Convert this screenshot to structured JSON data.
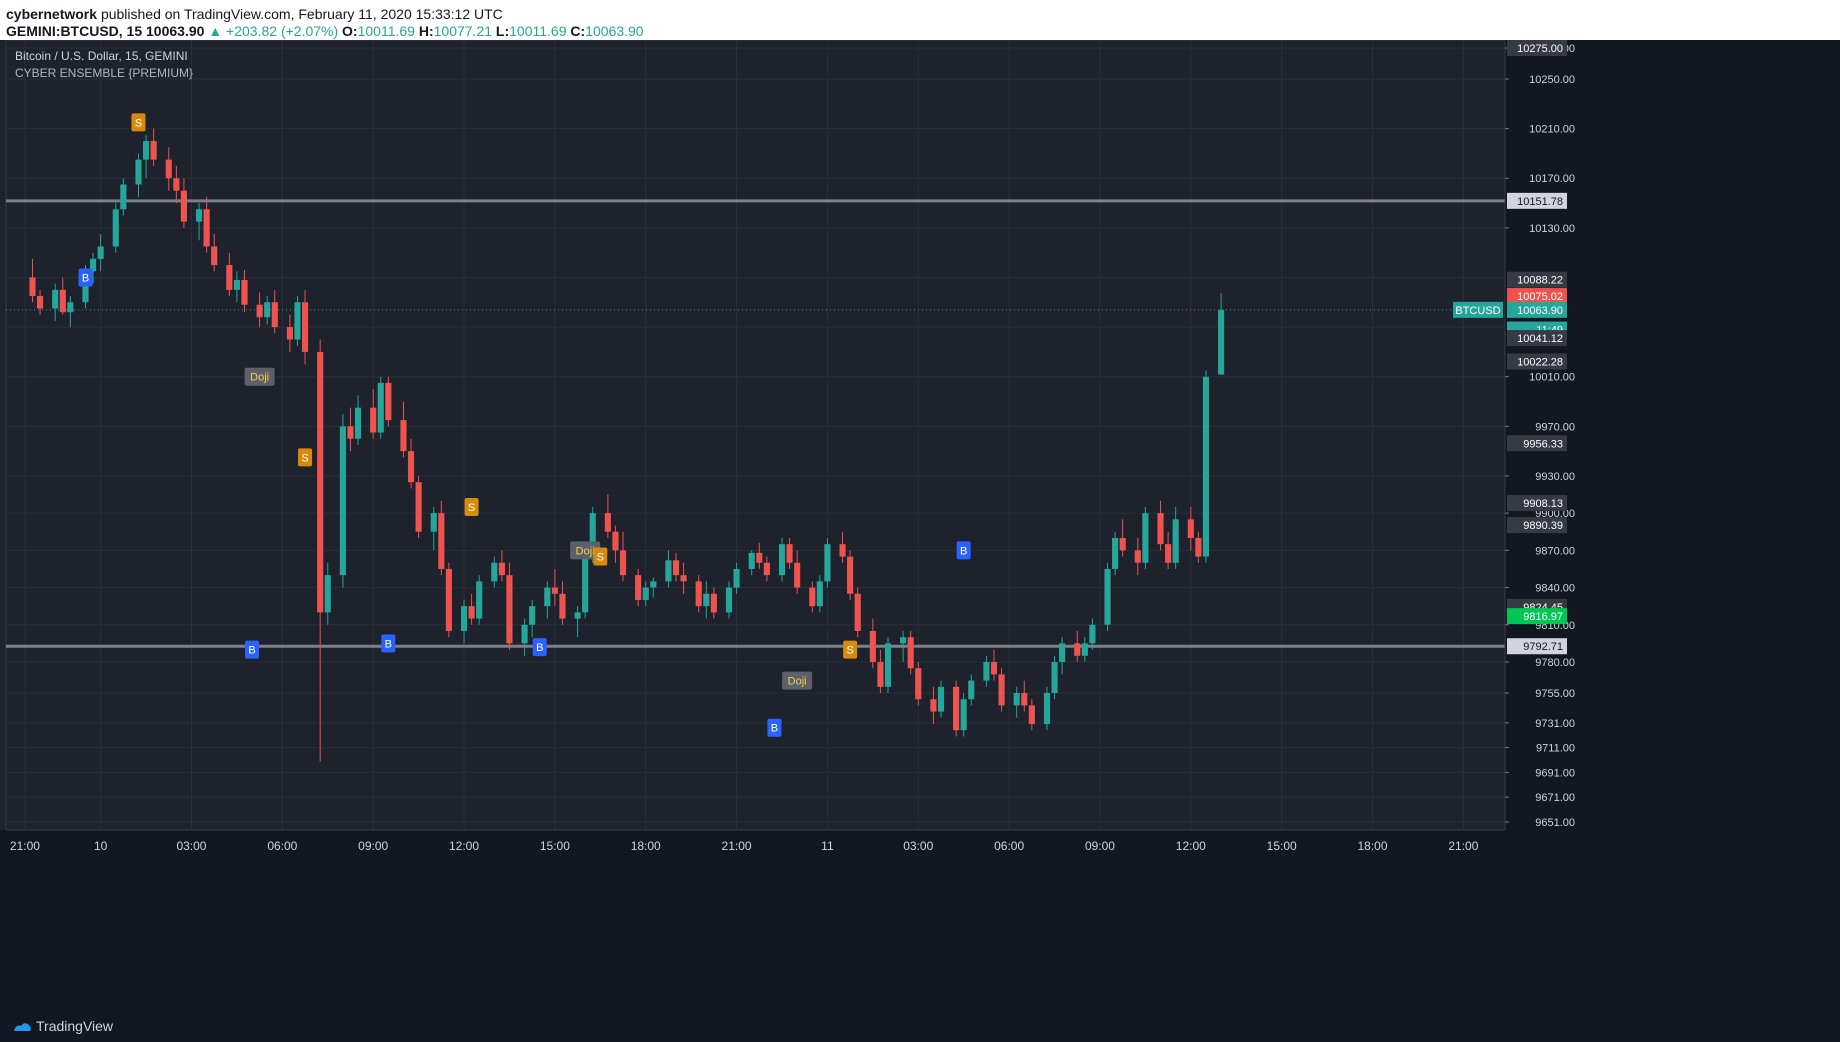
{
  "header": {
    "author": "cybernetwork",
    "published_text": "published on TradingView.com, February 11, 2020 15:33:12 UTC",
    "symbol": "GEMINI:BTCUSD, 15",
    "price": "10063.90",
    "change": "▲ +203.82 (+2.07%)",
    "ohlc": {
      "o_label": "O:",
      "o": "10011.69",
      "h_label": "H:",
      "h": "10077.21",
      "l_label": "L:",
      "l": "10011.69",
      "c_label": "C:",
      "c": "10063.90"
    }
  },
  "legend": {
    "title": "Bitcoin / U.S. Dollar, 15, GEMINI",
    "indicator": "CYBER ENSEMBLE {PREMIUM}"
  },
  "footer": {
    "brand": "TradingView"
  },
  "colors": {
    "up": "#26a69a",
    "down": "#ef5350",
    "background": "#1e222d",
    "grid": "#2a2e39",
    "axis_text": "#d1d4dc",
    "buy": "#2962ff",
    "sell": "#d88a0c"
  },
  "chart_data": {
    "type": "candlestick",
    "timeframe": "15",
    "ylim": [
      9651,
      10275
    ],
    "y_ticks": [
      10275,
      10250,
      10210,
      10170,
      10130,
      10090,
      10050,
      10010,
      9970,
      9930,
      9900,
      9870,
      9840,
      9810,
      9780,
      9755,
      9731,
      9711,
      9691,
      9671,
      9651
    ],
    "y_tick_labels": [
      "10275.00",
      "10250.00",
      "10210.00",
      "10170.00",
      "10130.00",
      "",
      "",
      "10010.00",
      "9970.00",
      "9930.00",
      "9900.00",
      "9870.00",
      "9840.00",
      "9810.00",
      "9780.00",
      "9755.00",
      "9731.00",
      "9711.00",
      "9691.00",
      "9671.00",
      "9651.00"
    ],
    "x_ticks": [
      "21:00",
      "10",
      "03:00",
      "06:00",
      "09:00",
      "12:00",
      "15:00",
      "18:00",
      "21:00",
      "11",
      "03:00",
      "06:00",
      "09:00",
      "12:00",
      "15:00",
      "18:00",
      "21:00"
    ],
    "x_tick_bar_index": [
      2,
      12,
      24,
      36,
      48,
      60,
      72,
      84,
      96,
      108,
      120,
      132,
      144,
      156,
      168,
      180,
      192
    ],
    "bars_total": 198,
    "ohlc": [
      [
        10090,
        10105,
        10070,
        10075
      ],
      [
        10075,
        10080,
        10060,
        10065
      ],
      [
        10065,
        10085,
        10055,
        10080
      ],
      [
        10080,
        10090,
        10060,
        10062
      ],
      [
        10062,
        10075,
        10050,
        10070
      ],
      [
        10070,
        10100,
        10065,
        10095
      ],
      [
        10095,
        10110,
        10085,
        10105
      ],
      [
        10105,
        10125,
        10095,
        10115
      ],
      [
        10115,
        10150,
        10110,
        10145
      ],
      [
        10145,
        10170,
        10140,
        10165
      ],
      [
        10165,
        10190,
        10155,
        10185
      ],
      [
        10185,
        10205,
        10170,
        10200
      ],
      [
        10200,
        10210,
        10180,
        10185
      ],
      [
        10185,
        10195,
        10160,
        10170
      ],
      [
        10170,
        10180,
        10150,
        10160
      ],
      [
        10160,
        10170,
        10130,
        10135
      ],
      [
        10135,
        10150,
        10120,
        10145
      ],
      [
        10145,
        10155,
        10110,
        10115
      ],
      [
        10115,
        10125,
        10095,
        10100
      ],
      [
        10100,
        10110,
        10075,
        10080
      ],
      [
        10080,
        10095,
        10070,
        10088
      ],
      [
        10088,
        10096,
        10062,
        10068
      ],
      [
        10068,
        10078,
        10050,
        10058
      ],
      [
        10058,
        10075,
        10052,
        10070
      ],
      [
        10070,
        10080,
        10045,
        10050
      ],
      [
        10050,
        10060,
        10030,
        10040
      ],
      [
        10040,
        10075,
        10035,
        10070
      ],
      [
        10070,
        10080,
        10020,
        10030
      ],
      [
        10030,
        10040,
        9700,
        9820
      ],
      [
        9820,
        9860,
        9810,
        9850
      ],
      [
        9850,
        9980,
        9840,
        9970
      ],
      [
        9970,
        9985,
        9950,
        9960
      ],
      [
        9960,
        9995,
        9955,
        9985
      ],
      [
        9985,
        10000,
        9960,
        9965
      ],
      [
        9965,
        10010,
        9960,
        10005
      ],
      [
        10005,
        10010,
        9970,
        9975
      ],
      [
        9975,
        9990,
        9945,
        9950
      ],
      [
        9950,
        9960,
        9920,
        9925
      ],
      [
        9925,
        9930,
        9880,
        9885
      ],
      [
        9885,
        9905,
        9870,
        9900
      ],
      [
        9900,
        9910,
        9850,
        9855
      ],
      [
        9855,
        9860,
        9800,
        9805
      ],
      [
        9805,
        9830,
        9795,
        9825
      ],
      [
        9825,
        9835,
        9810,
        9815
      ],
      [
        9815,
        9850,
        9810,
        9845
      ],
      [
        9845,
        9865,
        9840,
        9860
      ],
      [
        9860,
        9870,
        9845,
        9850
      ],
      [
        9850,
        9860,
        9790,
        9795
      ],
      [
        9795,
        9815,
        9785,
        9810
      ],
      [
        9810,
        9830,
        9800,
        9825
      ],
      [
        9825,
        9845,
        9815,
        9840
      ],
      [
        9840,
        9855,
        9825,
        9835
      ],
      [
        9835,
        9845,
        9810,
        9815
      ],
      [
        9815,
        9825,
        9800,
        9820
      ],
      [
        9820,
        9870,
        9815,
        9865
      ],
      [
        9865,
        9905,
        9860,
        9900
      ],
      [
        9900,
        9915,
        9880,
        9885
      ],
      [
        9885,
        9890,
        9860,
        9870
      ],
      [
        9870,
        9885,
        9845,
        9850
      ],
      [
        9850,
        9855,
        9825,
        9830
      ],
      [
        9830,
        9845,
        9825,
        9840
      ],
      [
        9840,
        9848,
        9832,
        9845
      ],
      [
        9845,
        9870,
        9840,
        9862
      ],
      [
        9862,
        9868,
        9845,
        9850
      ],
      [
        9850,
        9860,
        9835,
        9845
      ],
      [
        9845,
        9850,
        9820,
        9825
      ],
      [
        9825,
        9845,
        9815,
        9835
      ],
      [
        9835,
        9840,
        9815,
        9820
      ],
      [
        9820,
        9845,
        9815,
        9840
      ],
      [
        9840,
        9860,
        9835,
        9855
      ],
      [
        9855,
        9870,
        9850,
        9868
      ],
      [
        9868,
        9876,
        9855,
        9860
      ],
      [
        9860,
        9865,
        9845,
        9850
      ],
      [
        9850,
        9880,
        9845,
        9875
      ],
      [
        9875,
        9880,
        9855,
        9860
      ],
      [
        9860,
        9870,
        9835,
        9840
      ],
      [
        9840,
        9845,
        9820,
        9825
      ],
      [
        9825,
        9850,
        9820,
        9845
      ],
      [
        9845,
        9880,
        9840,
        9875
      ],
      [
        9875,
        9885,
        9860,
        9865
      ],
      [
        9865,
        9870,
        9830,
        9835
      ],
      [
        9835,
        9840,
        9800,
        9805
      ],
      [
        9805,
        9815,
        9775,
        9780
      ],
      [
        9780,
        9790,
        9755,
        9760
      ],
      [
        9760,
        9800,
        9755,
        9795
      ],
      [
        9795,
        9805,
        9780,
        9800
      ],
      [
        9800,
        9805,
        9770,
        9775
      ],
      [
        9775,
        9780,
        9745,
        9750
      ],
      [
        9750,
        9760,
        9730,
        9740
      ],
      [
        9740,
        9765,
        9735,
        9760
      ],
      [
        9760,
        9765,
        9720,
        9725
      ],
      [
        9725,
        9755,
        9720,
        9750
      ],
      [
        9750,
        9770,
        9745,
        9765
      ],
      [
        9765,
        9785,
        9760,
        9780
      ],
      [
        9780,
        9790,
        9765,
        9770
      ],
      [
        9770,
        9775,
        9740,
        9745
      ],
      [
        9745,
        9760,
        9735,
        9755
      ],
      [
        9755,
        9765,
        9740,
        9745
      ],
      [
        9745,
        9750,
        9725,
        9730
      ],
      [
        9730,
        9760,
        9725,
        9755
      ],
      [
        9755,
        9785,
        9750,
        9780
      ],
      [
        9780,
        9800,
        9770,
        9795
      ],
      [
        9795,
        9805,
        9780,
        9785
      ],
      [
        9785,
        9800,
        9780,
        9795
      ],
      [
        9795,
        9815,
        9790,
        9810
      ],
      [
        9810,
        9860,
        9805,
        9855
      ],
      [
        9855,
        9885,
        9850,
        9880
      ],
      [
        9880,
        9895,
        9865,
        9870
      ],
      [
        9870,
        9880,
        9850,
        9860
      ],
      [
        9860,
        9905,
        9855,
        9900
      ],
      [
        9900,
        9910,
        9870,
        9875
      ],
      [
        9875,
        9885,
        9855,
        9860
      ],
      [
        9860,
        9905,
        9855,
        9895
      ],
      [
        9895,
        9905,
        9870,
        9880
      ],
      [
        9880,
        9885,
        9860,
        9865
      ],
      [
        9865,
        10015,
        9860,
        10010
      ],
      [
        10011.69,
        10077.21,
        10011.69,
        10063.9
      ]
    ],
    "horizontal_levels": [
      10151.78,
      9792.71
    ],
    "price_labels": [
      {
        "label": "10275.00",
        "value": 10275
      },
      {
        "label": "10151.78",
        "value": 10151.78
      },
      {
        "label": "10088.22",
        "value": 10088.22
      },
      {
        "label": "10075.02",
        "value": 10075.02
      },
      {
        "label": "10063.90",
        "value": 10063.9
      },
      {
        "label": "11:49",
        "value": 10048
      },
      {
        "label": "10041.12",
        "value": 10041.12
      },
      {
        "label": "10022.28",
        "value": 10022.28
      },
      {
        "label": "9956.33",
        "value": 9956.33
      },
      {
        "label": "9908.13",
        "value": 9908.13
      },
      {
        "label": "9890.39",
        "value": 9890.39
      },
      {
        "label": "9824.45",
        "value": 9824.45
      },
      {
        "label": "9816.97",
        "value": 9816.97
      },
      {
        "label": "9792.71",
        "value": 9792.71
      }
    ],
    "symbol_tag": "BTCUSD",
    "signals": [
      {
        "text": "S",
        "bar": 18,
        "value": 10215
      },
      {
        "text": "B",
        "bar": 9,
        "value": 10090
      },
      {
        "text": "Doji",
        "bar": 37,
        "value": 10010
      },
      {
        "text": "B",
        "bar": 36,
        "value": 9790
      },
      {
        "text": "S",
        "bar": 45,
        "value": 9945
      },
      {
        "text": "B",
        "bar": 59,
        "value": 9795
      },
      {
        "text": "S",
        "bar": 73,
        "value": 9905
      },
      {
        "text": "B",
        "bar": 84,
        "value": 9792
      },
      {
        "text": "Doji",
        "bar": 91,
        "value": 9870
      },
      {
        "text": "S",
        "bar": 94,
        "value": 9865
      },
      {
        "text": "B",
        "bar": 123,
        "value": 9727
      },
      {
        "text": "Doji",
        "bar": 126,
        "value": 9765
      },
      {
        "text": "S",
        "bar": 135,
        "value": 9790
      },
      {
        "text": "B",
        "bar": 154,
        "value": 9870
      }
    ]
  }
}
